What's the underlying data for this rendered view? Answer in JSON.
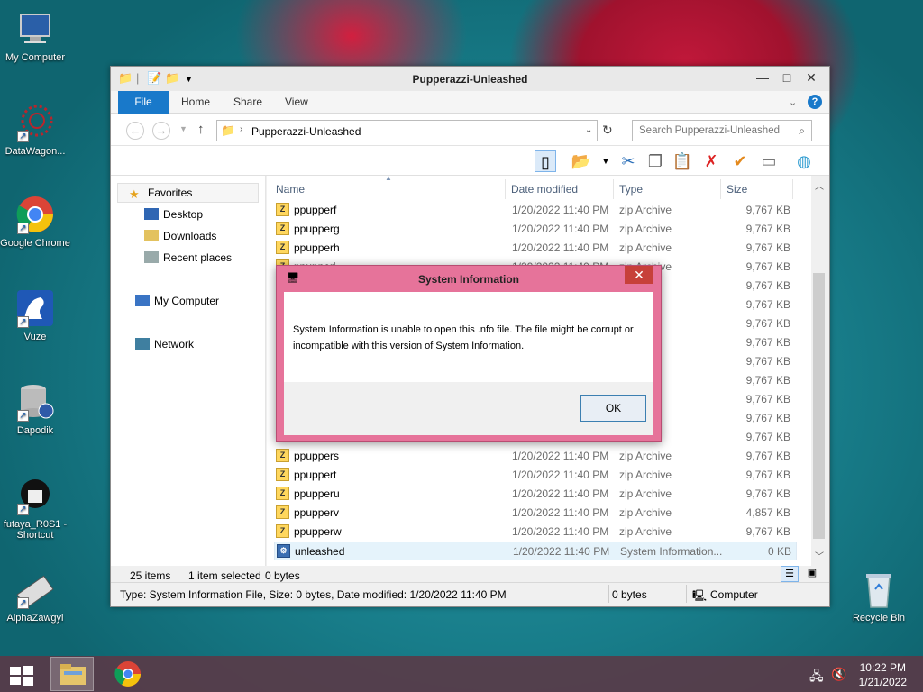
{
  "desktop": {
    "icons": [
      {
        "label": "My Computer"
      },
      {
        "label": "DataWagon..."
      },
      {
        "label": "Google Chrome"
      },
      {
        "label": "Vuze"
      },
      {
        "label": "Dapodik"
      },
      {
        "label": "futaya_R0S1 - Shortcut"
      },
      {
        "label": "AlphaZawgyi"
      },
      {
        "label": "Recycle Bin"
      }
    ]
  },
  "window": {
    "title": "Pupperazzi-Unleashed",
    "controls": {
      "minimize": "—",
      "maximize": "□",
      "close": "✕"
    },
    "ribbon_tabs": [
      "File",
      "Home",
      "Share",
      "View"
    ],
    "address": "Pupperazzi-Unleashed",
    "search_placeholder": "Search Pupperazzi-Unleashed",
    "nav": {
      "favorites": "Favorites",
      "desktop": "Desktop",
      "downloads": "Downloads",
      "recent": "Recent places",
      "computer": "My Computer",
      "network": "Network"
    },
    "columns": {
      "name": "Name",
      "date": "Date modified",
      "type": "Type",
      "size": "Size"
    },
    "files": [
      {
        "name": "ppupperf",
        "date": "1/20/2022 11:40 PM",
        "type": "zip Archive",
        "size": "9,767 KB"
      },
      {
        "name": "ppupperg",
        "date": "1/20/2022 11:40 PM",
        "type": "zip Archive",
        "size": "9,767 KB"
      },
      {
        "name": "ppupperh",
        "date": "1/20/2022 11:40 PM",
        "type": "zip Archive",
        "size": "9,767 KB"
      },
      {
        "name": "ppupperi",
        "date": "1/20/2022 11:40 PM",
        "type": "zip Archive",
        "size": "9,767 KB"
      },
      {
        "name": "",
        "date": "",
        "type": "",
        "size": "9,767 KB"
      },
      {
        "name": "",
        "date": "",
        "type": "",
        "size": "9,767 KB"
      },
      {
        "name": "",
        "date": "",
        "type": "",
        "size": "9,767 KB"
      },
      {
        "name": "",
        "date": "",
        "type": "",
        "size": "9,767 KB"
      },
      {
        "name": "",
        "date": "",
        "type": "",
        "size": "9,767 KB"
      },
      {
        "name": "",
        "date": "",
        "type": "",
        "size": "9,767 KB"
      },
      {
        "name": "",
        "date": "",
        "type": "",
        "size": "9,767 KB"
      },
      {
        "name": "",
        "date": "",
        "type": "",
        "size": "9,767 KB"
      },
      {
        "name": "",
        "date": "",
        "type": "",
        "size": "9,767 KB"
      },
      {
        "name": "ppuppers",
        "date": "1/20/2022 11:40 PM",
        "type": "zip Archive",
        "size": "9,767 KB"
      },
      {
        "name": "ppuppert",
        "date": "1/20/2022 11:40 PM",
        "type": "zip Archive",
        "size": "9,767 KB"
      },
      {
        "name": "ppupperu",
        "date": "1/20/2022 11:40 PM",
        "type": "zip Archive",
        "size": "9,767 KB"
      },
      {
        "name": "ppupperv",
        "date": "1/20/2022 11:40 PM",
        "type": "zip Archive",
        "size": "4,857 KB"
      },
      {
        "name": "ppupperw",
        "date": "1/20/2022 11:40 PM",
        "type": "zip Archive",
        "size": "9,767 KB"
      },
      {
        "name": "unleashed",
        "date": "1/20/2022 11:40 PM",
        "type": "System Information...",
        "size": "0 KB"
      }
    ],
    "item_count": "25 items",
    "selected": "1 item selected",
    "selected_size": "0 bytes",
    "status": {
      "details": "Type: System Information File, Size: 0 bytes, Date modified: 1/20/2022 11:40 PM",
      "size": "0 bytes",
      "location": "Computer"
    }
  },
  "dialog": {
    "title": "System Information",
    "message": "System Information is unable to open this .nfo file.  The file might be corrupt or incompatible with this version of System Information.",
    "ok_label": "OK",
    "close": "✕"
  },
  "taskbar": {
    "time": "10:22 PM",
    "date": "1/21/2022"
  },
  "colors": {
    "accent": "#1979ca",
    "dialog_frame": "#e6739a",
    "close_red": "#c7403a"
  }
}
